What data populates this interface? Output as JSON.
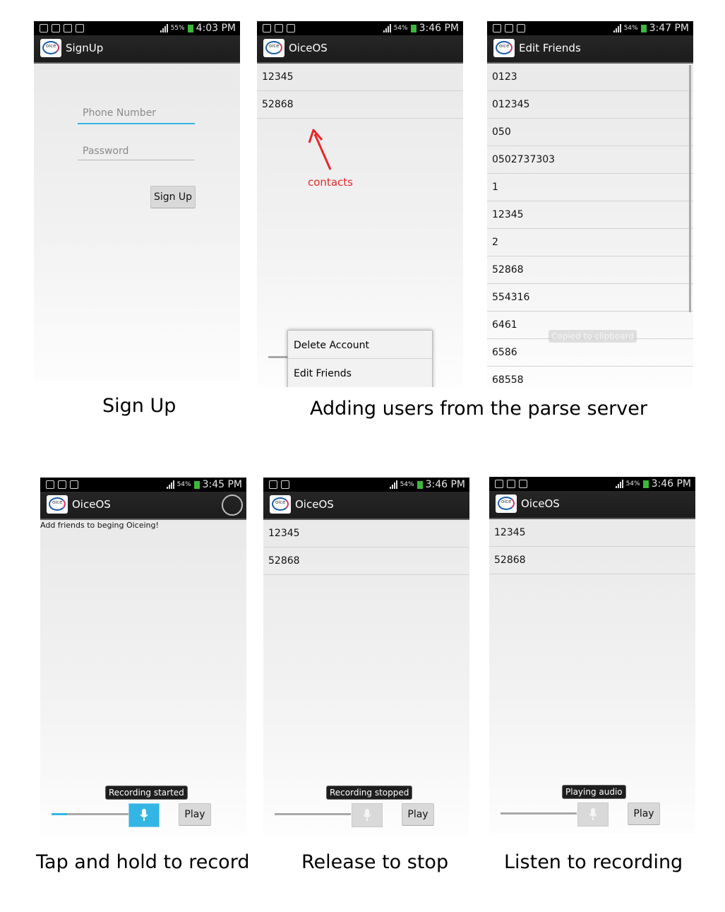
{
  "status_bars": {
    "s1": {
      "time": "4:03 PM",
      "battery": "55%"
    },
    "s2": {
      "time": "3:46 PM",
      "battery": "54%"
    },
    "s3": {
      "time": "3:47 PM",
      "battery": "54%"
    },
    "s4": {
      "time": "3:45 PM",
      "battery": "54%"
    },
    "s5": {
      "time": "3:46 PM",
      "battery": "54%"
    },
    "s6": {
      "time": "3:46 PM",
      "battery": "54%"
    }
  },
  "logo_text": "oice",
  "screen1": {
    "title": "SignUp",
    "phone_placeholder": "Phone Number",
    "password_placeholder": "Password",
    "signup_button": "Sign Up",
    "caption": "Sign Up"
  },
  "screen2": {
    "title": "OiceOS",
    "contacts": [
      "12345",
      "52868"
    ],
    "annotation": "contacts",
    "menu": [
      "Delete Account",
      "Edit Friends"
    ],
    "caption": "Adding users from the parse server"
  },
  "screen3": {
    "title": "Edit Friends",
    "friends": [
      "0123",
      "012345",
      "050",
      "0502737303",
      "1",
      "12345",
      "2",
      "52868",
      "554316",
      "6461",
      "6586",
      "68558"
    ],
    "toast": "Copied to clipboard"
  },
  "screen4": {
    "title": "OiceOS",
    "message": "Add friends to beging Oiceing!",
    "toast": "Recording started",
    "play_button": "Play",
    "caption": "Tap and hold to record",
    "seek_progress": 0.2
  },
  "screen5": {
    "title": "OiceOS",
    "contacts": [
      "12345",
      "52868"
    ],
    "toast": "Recording stopped",
    "play_button": "Play",
    "caption": "Release to stop"
  },
  "screen6": {
    "title": "OiceOS",
    "contacts": [
      "12345",
      "52868"
    ],
    "toast": "Playing audio",
    "play_button": "Play",
    "caption": "Listen to recording"
  },
  "colors": {
    "accent": "#33b5e5",
    "annotation": "#e8262b",
    "battery": "#3db83d"
  }
}
